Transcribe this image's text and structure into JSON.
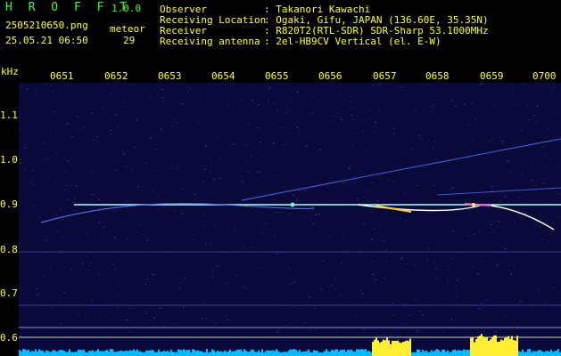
{
  "app": {
    "name": "H R O F F T",
    "version": "1.0.0"
  },
  "file": {
    "name": "2505210650.png",
    "datetime": "25.05.21 06:50"
  },
  "meteor": {
    "label": "meteor",
    "count": "29"
  },
  "info": {
    "labels": [
      "Observer",
      "Receiving Location",
      "Receiver",
      "Receiving antenna"
    ],
    "values": [
      ": Takanori Kawachi",
      ": Ogaki, Gifu, JAPAN (136.60E, 35.35N)",
      ": R820T2(RTL-SDR) SDR-Sharp 53.1000MHz",
      ": 2el-HB9CV Vertical (el. E-W)"
    ]
  },
  "x_axis": {
    "ticks": [
      "0651",
      "0652",
      "0653",
      "0654",
      "0655",
      "0656",
      "0657",
      "0658",
      "0659",
      "0700"
    ]
  },
  "y_axis": {
    "unit": "kHz",
    "ticks": [
      "1.1",
      "1.0",
      "0.9",
      "0.8",
      "0.7",
      "0.6"
    ]
  },
  "colors": {
    "background": "#000000",
    "label": "#ffff33",
    "title": "#33ff33",
    "text": "#ffffff",
    "carrier": "#aaffff",
    "spectrum": "#00bbff",
    "noise": "#1a1a6a"
  }
}
